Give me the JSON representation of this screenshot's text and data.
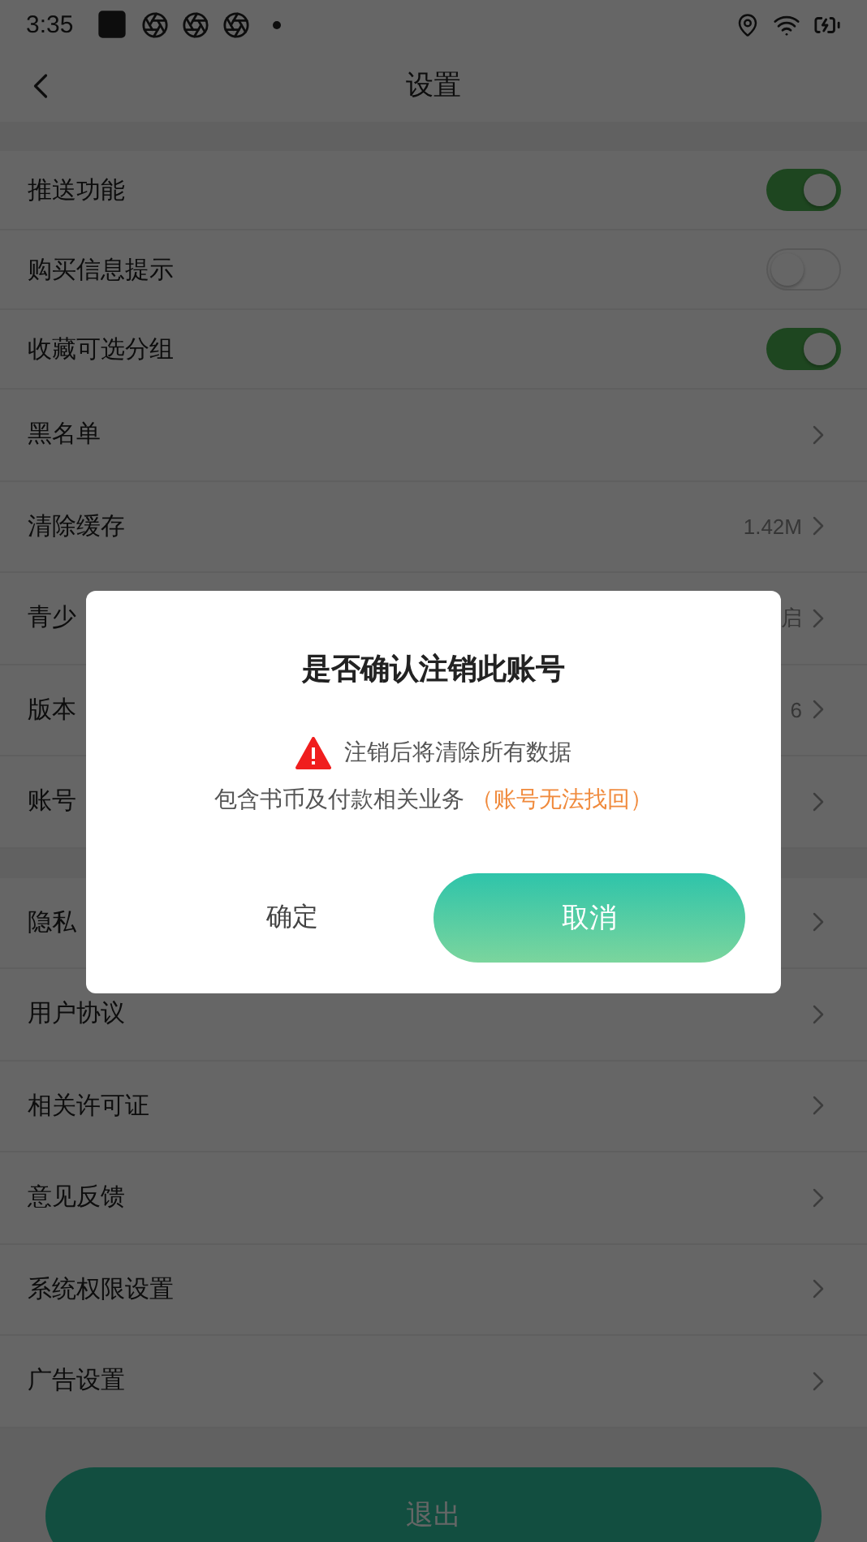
{
  "status_bar": {
    "time": "3:35"
  },
  "header": {
    "title": "设置"
  },
  "groups": [
    {
      "items": [
        {
          "kind": "toggle",
          "label": "推送功能",
          "on": true
        },
        {
          "kind": "toggle",
          "label": "购买信息提示",
          "on": false
        },
        {
          "kind": "toggle",
          "label": "收藏可选分组",
          "on": true
        },
        {
          "kind": "link",
          "label": "黑名单"
        },
        {
          "kind": "link",
          "label": "清除缓存",
          "value": "1.42M"
        },
        {
          "kind": "link",
          "label": "青少",
          "value": "启"
        },
        {
          "kind": "link",
          "label": "版本",
          "value": "6"
        },
        {
          "kind": "link",
          "label": "账号"
        }
      ]
    },
    {
      "items": [
        {
          "kind": "link",
          "label": "隐私"
        },
        {
          "kind": "link",
          "label": "用户协议"
        },
        {
          "kind": "link",
          "label": "相关许可证"
        },
        {
          "kind": "link",
          "label": "意见反馈"
        },
        {
          "kind": "link",
          "label": "系统权限设置"
        },
        {
          "kind": "link",
          "label": "广告设置"
        }
      ]
    }
  ],
  "logout_button": "退出",
  "dialog": {
    "title": "是否确认注销此账号",
    "warning": "注销后将清除所有数据",
    "note": "包含书币及付款相关业务",
    "note_highlight": "（账号无法找回）",
    "buttons": [
      {
        "kind": "plain",
        "label": "确定"
      },
      {
        "kind": "primary",
        "label": "取消"
      }
    ]
  }
}
